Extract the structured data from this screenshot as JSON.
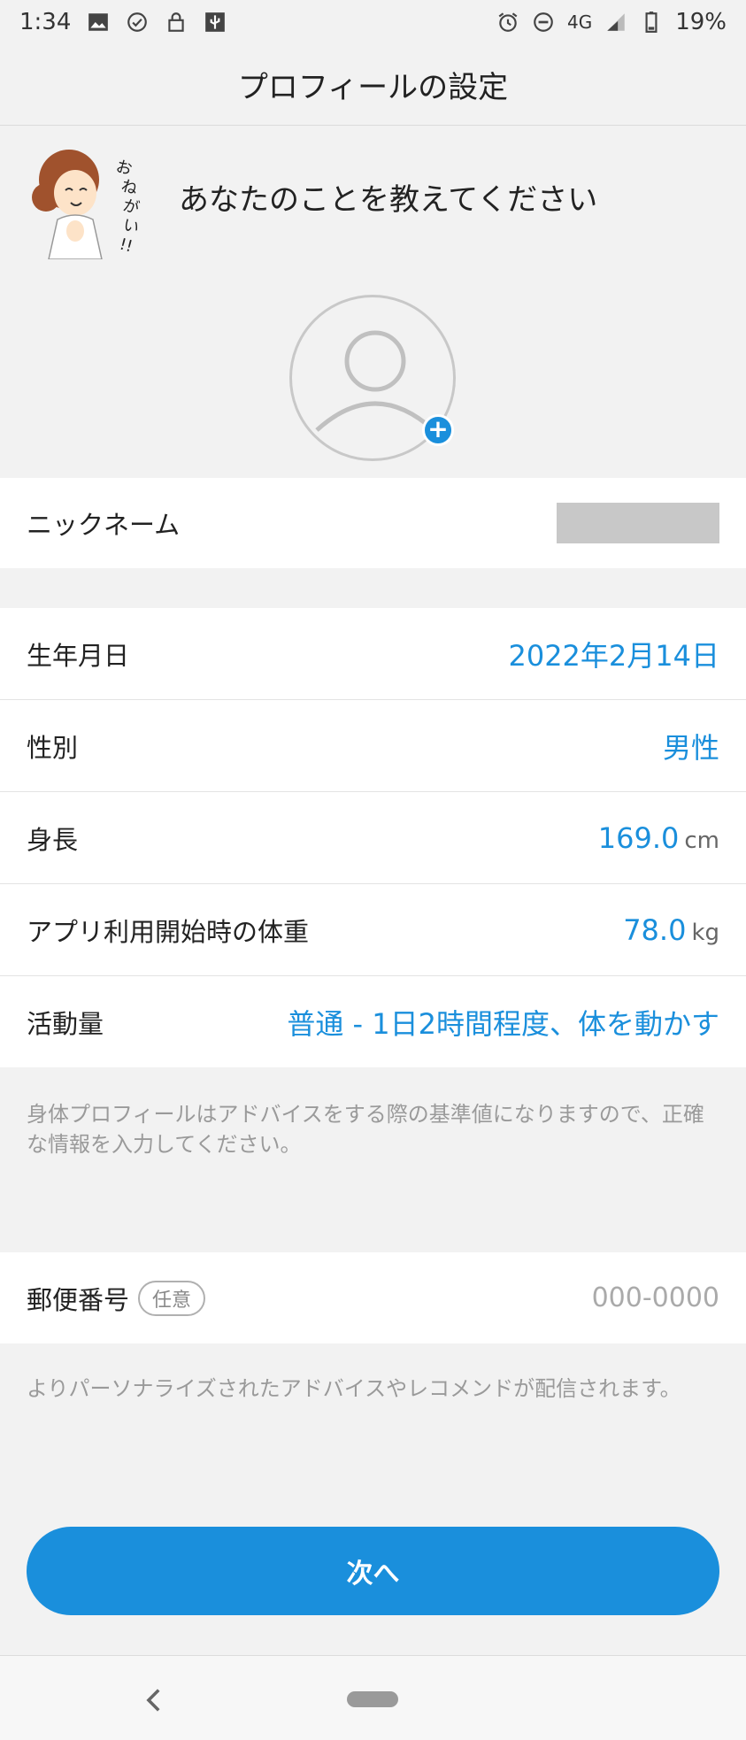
{
  "status_bar": {
    "time": "1:34",
    "network": "4G",
    "battery": "19%",
    "icons": [
      "image-icon",
      "check-circle-icon",
      "lock-icon",
      "usb-icon",
      "alarm-icon",
      "do-not-disturb-icon",
      "signal-icon",
      "battery-icon"
    ]
  },
  "header": {
    "title": "プロフィールの設定"
  },
  "intro": {
    "mascot_text": "おねがい!!",
    "message": "あなたのことを教えてください"
  },
  "profile": {
    "nickname_label": "ニックネーム",
    "birthday_label": "生年月日",
    "birthday_value": "2022年2月14日",
    "gender_label": "性別",
    "gender_value": "男性",
    "height_label": "身長",
    "height_value": "169.0",
    "height_unit": "cm",
    "weight_label": "アプリ利用開始時の体重",
    "weight_value": "78.0",
    "weight_unit": "kg",
    "activity_label": "活動量",
    "activity_value": "普通 - 1日2時間程度、体を動かす"
  },
  "notes": {
    "profile_note": "身体プロフィールはアドバイスをする際の基準値になりますので、正確な情報を入力してください。",
    "postal_note": "よりパーソナライズされたアドバイスやレコメンドが配信されます。"
  },
  "postal": {
    "label": "郵便番号",
    "optional_badge": "任意",
    "placeholder": "000-0000"
  },
  "actions": {
    "next_label": "次へ"
  },
  "colors": {
    "accent": "#1a8fdc",
    "background": "#f2f2f2"
  }
}
